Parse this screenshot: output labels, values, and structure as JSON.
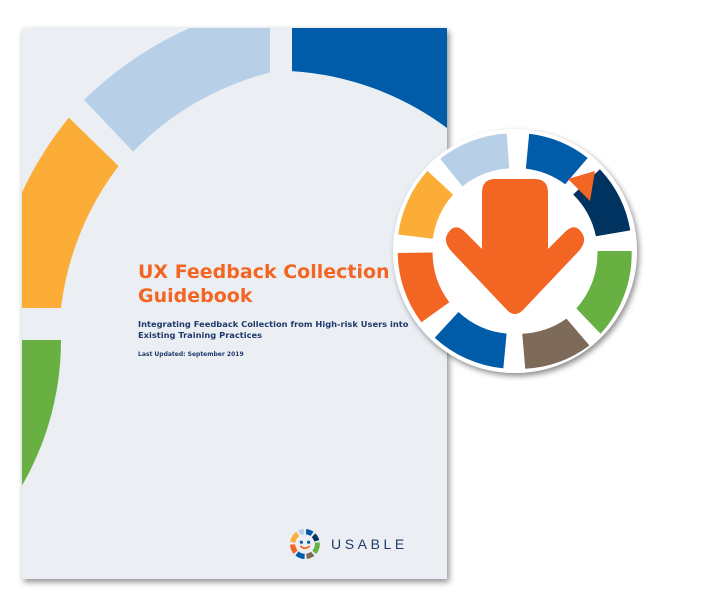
{
  "document": {
    "title": "UX Feedback Collection Guidebook",
    "subtitle": "Integrating Feedback Collection from High-risk Users into Existing Training Practices",
    "last_updated": "Last Updated: September 2019",
    "brand_name": "USABLE",
    "brand_logo_icon": "usable-smiley-ring-icon"
  },
  "badge": {
    "icon": "download-arrow-icon",
    "arrow_color": "#f26522",
    "ring_colors": [
      "#005ba9",
      "#00335f",
      "#68b042",
      "#7d6a58",
      "#005ba9",
      "#f26522",
      "#fbad38",
      "#b8cfe8"
    ]
  },
  "colors": {
    "page_background": "#ebeff4",
    "title": "#f26522",
    "subtitle": "#1f3a6b",
    "arc_green": "#68b042",
    "arc_orange": "#fbad38",
    "arc_lightblue": "#b8cfe8",
    "arc_blue": "#005ba9"
  }
}
